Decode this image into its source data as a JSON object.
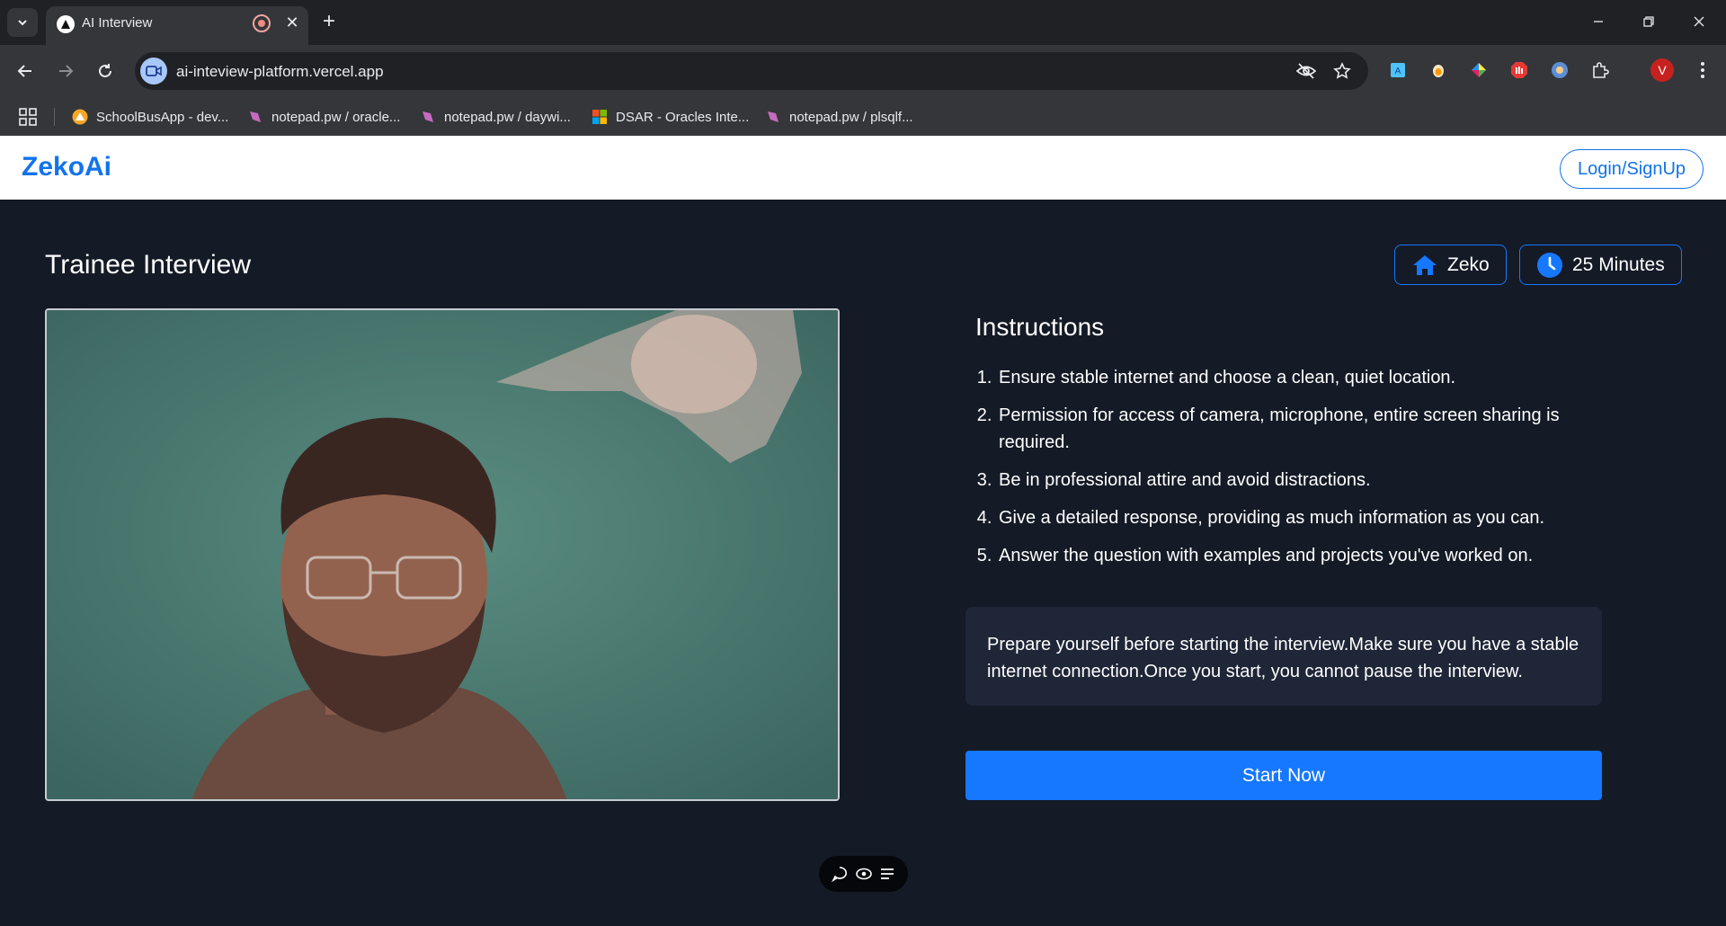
{
  "browser": {
    "tab": {
      "title": "AI Interview"
    },
    "address_bar": {
      "url": "ai-inteview-platform.vercel.app"
    },
    "bookmarks": [
      {
        "label": "SchoolBusApp - dev...",
        "icon": "warning-triangle-icon",
        "color": "#f9a825"
      },
      {
        "label": "notepad.pw / oracle...",
        "icon": "notepad-icon",
        "color": "#c66bbf"
      },
      {
        "label": "notepad.pw / daywi...",
        "icon": "notepad-icon",
        "color": "#c66bbf"
      },
      {
        "label": "DSAR - Oracles Inte...",
        "icon": "microsoft-icon",
        "color": "#f25022"
      },
      {
        "label": "notepad.pw / plsqlf...",
        "icon": "notepad-icon",
        "color": "#c66bbf"
      }
    ],
    "profile_initial": "V"
  },
  "header": {
    "brand": "ZekoAi",
    "login_label": "Login/SignUp"
  },
  "interview": {
    "title": "Trainee Interview",
    "company_chip": "Zeko",
    "duration_chip": "25 Minutes"
  },
  "instructions": {
    "title": "Instructions",
    "items": [
      "Ensure stable internet and choose a clean, quiet location.",
      "Permission for access of camera, microphone, entire screen sharing is required.",
      "Be in professional attire and avoid distractions.",
      "Give a detailed response, providing as much information as you can.",
      "Answer the question with examples and projects you've worked on."
    ]
  },
  "notice": "Prepare yourself before starting the interview.Make sure you have a stable internet connection.Once you start, you cannot pause the interview.",
  "start_label": "Start Now",
  "colors": {
    "brand_blue": "#1273eb",
    "primary": "#1677ff",
    "page_bg": "#141a26",
    "card_bg": "#1e2637"
  }
}
